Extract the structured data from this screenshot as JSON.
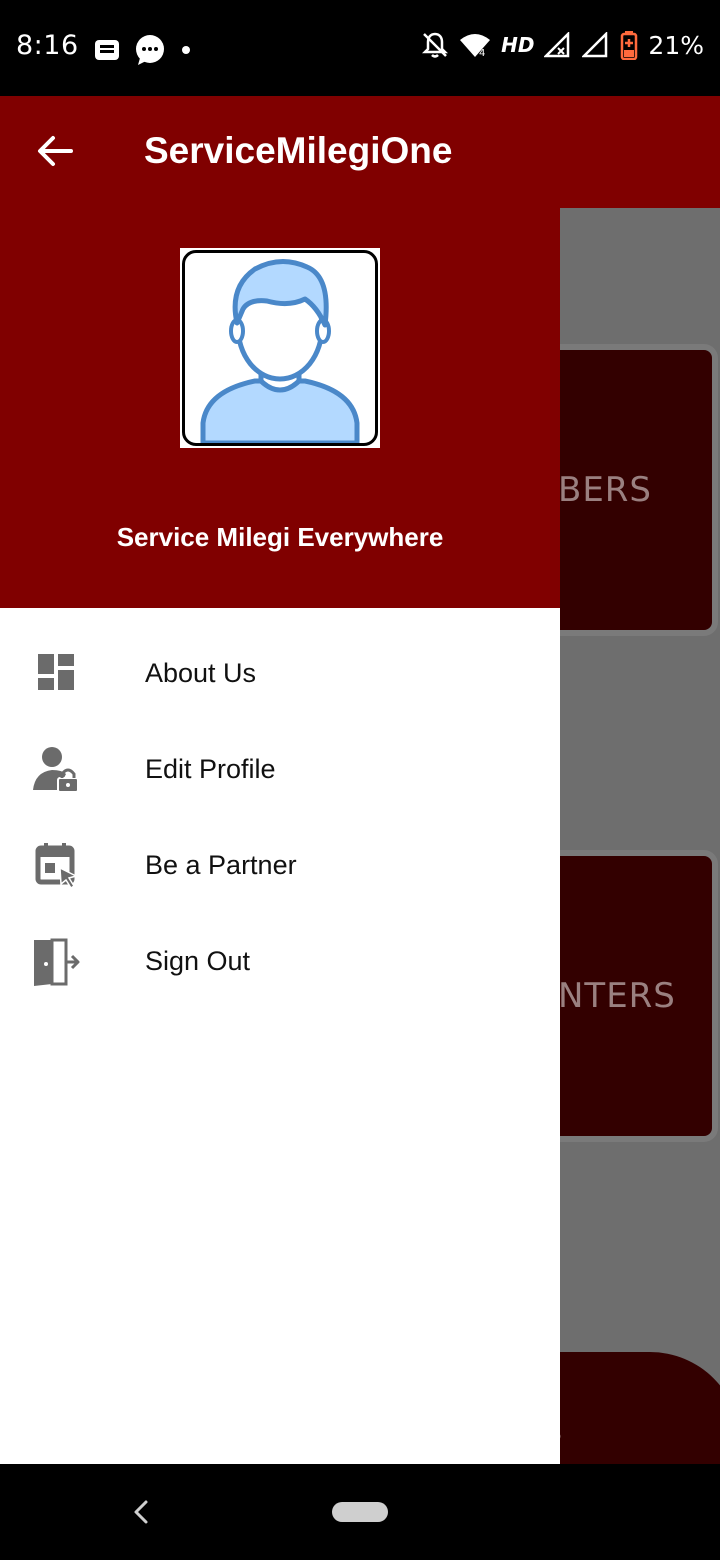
{
  "status_bar": {
    "time": "8:16",
    "network": "HD",
    "battery": "21%"
  },
  "app_bar": {
    "title": "ServiceMilegiOne"
  },
  "background_cards": [
    {
      "label": "BERS"
    },
    {
      "label": "NTERS"
    }
  ],
  "background_bottom_text": "gs",
  "drawer": {
    "subtitle": "Service Milegi Everywhere",
    "items": [
      {
        "label": "About Us",
        "icon": "dashboard-icon"
      },
      {
        "label": "Edit Profile",
        "icon": "user-lock-icon"
      },
      {
        "label": "Be a Partner",
        "icon": "calendar-cursor-icon"
      },
      {
        "label": "Sign Out",
        "icon": "door-exit-icon"
      }
    ]
  },
  "colors": {
    "primary": "#800000",
    "card_dark": "#330000",
    "scrim": "#6e6e6e",
    "avatar_blue": "#b3d9ff",
    "avatar_outline": "#4a88c9"
  }
}
